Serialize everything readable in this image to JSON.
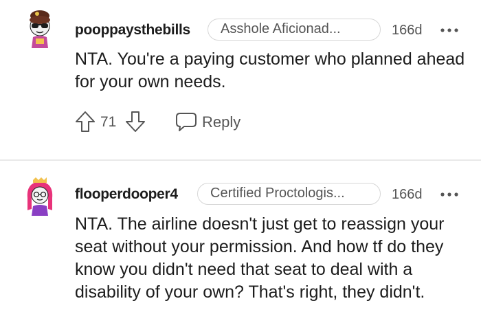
{
  "comments": [
    {
      "username": "pooppaysthebills",
      "flair": "Asshole Aficionad...",
      "time": "166d",
      "body": "NTA. You're a paying customer who planned ahead for your own needs.",
      "score": "71",
      "reply_label": "Reply"
    },
    {
      "username": "flooperdooper4",
      "flair": "Certified Proctologis...",
      "time": "166d",
      "body": "NTA. The airline doesn't just get to reassign your seat without your permission. And how tf do they know you didn't need that seat to deal with a disability of your own? That's right, they didn't."
    }
  ],
  "colors": {
    "text": "#1c1c1c",
    "muted": "#555555",
    "flair_border": "#d6d6d6",
    "divider": "#e9e9e9"
  },
  "icons": [
    "avatar",
    "more-icon",
    "upvote-icon",
    "downvote-icon",
    "reply-icon"
  ]
}
